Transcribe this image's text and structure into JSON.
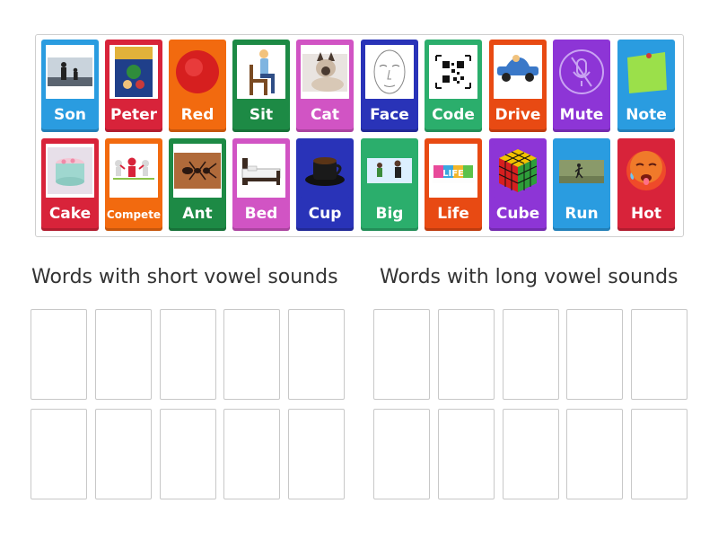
{
  "cards": [
    {
      "label": "Son",
      "color": "#2a9ce0",
      "icon": "family-silhouette-photo"
    },
    {
      "label": "Peter",
      "color": "#d8233a",
      "icon": "peter-pan-poster"
    },
    {
      "label": "Red",
      "color": "#f26a0f",
      "icon": "red-circle"
    },
    {
      "label": "Sit",
      "color": "#1d8a45",
      "icon": "sitting-man"
    },
    {
      "label": "Cat",
      "color": "#d154c4",
      "icon": "siamese-cat-photo"
    },
    {
      "label": "Face",
      "color": "#2933b8",
      "icon": "face-sketch"
    },
    {
      "label": "Code",
      "color": "#2bae6c",
      "icon": "qr-code"
    },
    {
      "label": "Drive",
      "color": "#e84a13",
      "icon": "cartoon-car"
    },
    {
      "label": "Mute",
      "color": "#8d35d6",
      "icon": "mute-microphone"
    },
    {
      "label": "Note",
      "color": "#2a9ce0",
      "icon": "sticky-note"
    },
    {
      "label": "Cake",
      "color": "#d8233a",
      "icon": "cake-photo"
    },
    {
      "label": "Compete",
      "color": "#f26a0f",
      "icon": "race-figures"
    },
    {
      "label": "Ant",
      "color": "#1d8a45",
      "icon": "ant-photo"
    },
    {
      "label": "Bed",
      "color": "#d154c4",
      "icon": "bed-photo"
    },
    {
      "label": "Cup",
      "color": "#2933b8",
      "icon": "coffee-cup-photo"
    },
    {
      "label": "Big",
      "color": "#2bae6c",
      "icon": "big-small-people"
    },
    {
      "label": "Life",
      "color": "#e84a13",
      "icon": "game-of-life-logo"
    },
    {
      "label": "Cube",
      "color": "#8d35d6",
      "icon": "rubiks-cube"
    },
    {
      "label": "Run",
      "color": "#2a9ce0",
      "icon": "running-photo"
    },
    {
      "label": "Hot",
      "color": "#d8233a",
      "icon": "hot-face-emoji"
    }
  ],
  "pictureText": {
    "life": "LIFE"
  },
  "groups": [
    {
      "title": "Words with short vowel sounds"
    },
    {
      "title": "Words with long vowel sounds"
    }
  ]
}
